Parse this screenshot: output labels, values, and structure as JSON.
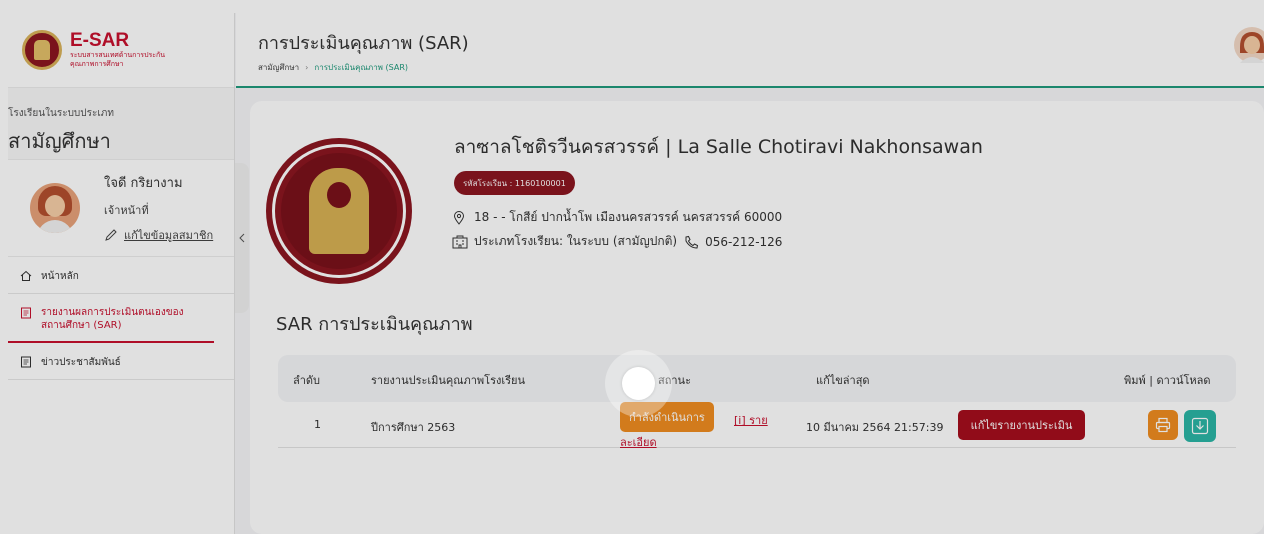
{
  "app": {
    "logo_title": "E-SAR",
    "logo_sub_line1": "ระบบสารสนเทศด้านการประกัน",
    "logo_sub_line2": "คุณภาพการศึกษา"
  },
  "sidebar": {
    "school_type_label": "โรงเรียนในระบบประเภท",
    "school_type_value": "สามัญศึกษา",
    "profile": {
      "name": "ใจดี กริยางาม",
      "role": "เจ้าหน้าที่",
      "edit_link": "แก้ไขข้อมูลสมาชิก"
    },
    "items": [
      {
        "label": "หน้าหลัก",
        "icon": "home-icon",
        "active": false
      },
      {
        "label": "รายงานผลการประเมินตนเองของสถานศึกษา (SAR)",
        "icon": "document-icon",
        "active": true
      },
      {
        "label": "ข่าวประชาสัมพันธ์",
        "icon": "document-icon",
        "active": false
      }
    ],
    "collapse_icon": "chevron-left-icon"
  },
  "header": {
    "title": "การประเมินคุณภาพ (SAR)",
    "breadcrumb": [
      "สามัญศึกษา",
      "การประเมินคุณภาพ (SAR)"
    ]
  },
  "school": {
    "name": "ลาซาลโชติรวีนครสวรรค์ | La Salle Chotiravi Nakhonsawan",
    "code_badge": "รหัสโรงเรียน : 1160100001",
    "address": "18 - - โกสีย์ ปากน้ำโพ เมืองนครสวรรค์ นครสวรรค์ 60000",
    "type": "ประเภทโรงเรียน: ในระบบ (สามัญปกติ)",
    "phone": "056-212-126"
  },
  "sar": {
    "heading": "SAR การประเมินคุณภาพ",
    "columns": [
      "ลำดับ",
      "รายงานประเมินคุณภาพโรงเรียน",
      "สถานะ",
      "แก้ไขล่าสุด",
      "พิมพ์ | ดาวน์โหลด"
    ],
    "rows": [
      {
        "no": "1",
        "report": "ปีการศึกษา 2563",
        "status": "กำลังดำเนินการ",
        "details_part1": "[i] ราย",
        "details_part2": "ละเอียด",
        "updated": "10 มีนาคม 2564 21:57:39",
        "edit_label": "แก้ไขรายงานประเมิน"
      }
    ]
  },
  "colors": {
    "brand_red": "#c8102e",
    "badge_maroon": "#8b1620",
    "accent_green": "#1f9a7d",
    "status_orange": "#ef8d20",
    "download_teal": "#2bb5a6"
  }
}
